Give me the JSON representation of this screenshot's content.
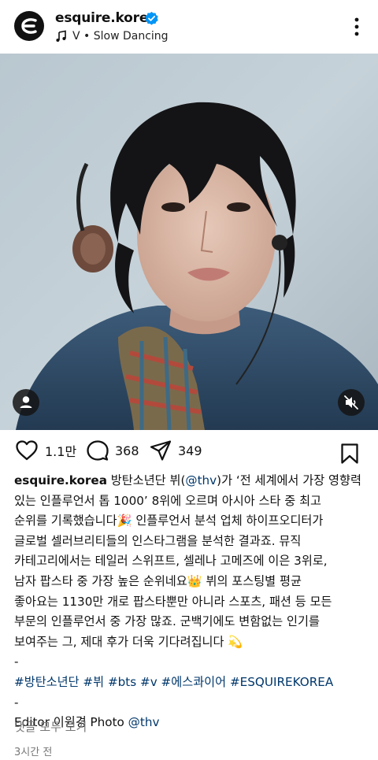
{
  "post": {
    "username": "esquire.korea",
    "music": "V • Slow Dancing",
    "likes": "1.1만",
    "comments_count": "368",
    "shares": "349",
    "caption_username": "esquire.korea",
    "caption_lines": [
      "방탄소년단 뷔(",
      "@thv",
      ")가 ‘전 세계에서 가장 영향력",
      "있는 인플루언서 톱 1000’ 8위에 오르며 아시아 스타 중 최고",
      "순위를 기록했습니다🎉 인플루언서 분석 업체 하이프오디터가",
      "글로벌 셀러브리티들의 인스타그램을 분석한 결과죠. 뮤직",
      "카테고리에서는 테일러 스위프트, 셀레나 고메즈에 이은 3위로,",
      "남자 팝스타 중 가장 높은 순위네요👑 뷔의 포스팅별 평균",
      "좋아요는 1130만 개로 팝스타뿐만 아니라 스포츠, 패션 등 모든",
      "부문의 인플루언서 중 가장 많죠. 군백기에도 변함없는 인기를",
      "보여주는 그, 제대 후가 더욱 기다려집니다 💫"
    ],
    "dash": "-",
    "hashtags": "#방탄소년단 #뷔 #bts #v #에스콰이어 #ESQUIREKOREA",
    "editor_prefix": "Editor 이원경 Photo ",
    "editor_link": "@thv",
    "view_comments": "댓글 모두 보기",
    "time_ago": "3시간 전"
  },
  "icons": {
    "verified": "verified-badge-icon",
    "music": "music-note-icon",
    "more": "more-vertical-icon",
    "tag": "user-tag-icon",
    "mute": "muted-speaker-icon",
    "like": "heart-icon",
    "comment": "comment-bubble-icon",
    "share": "paper-plane-icon",
    "save": "bookmark-icon"
  },
  "colors": {
    "link": "#00376b",
    "verified": "#0095f6",
    "muted_text": "#777777"
  }
}
